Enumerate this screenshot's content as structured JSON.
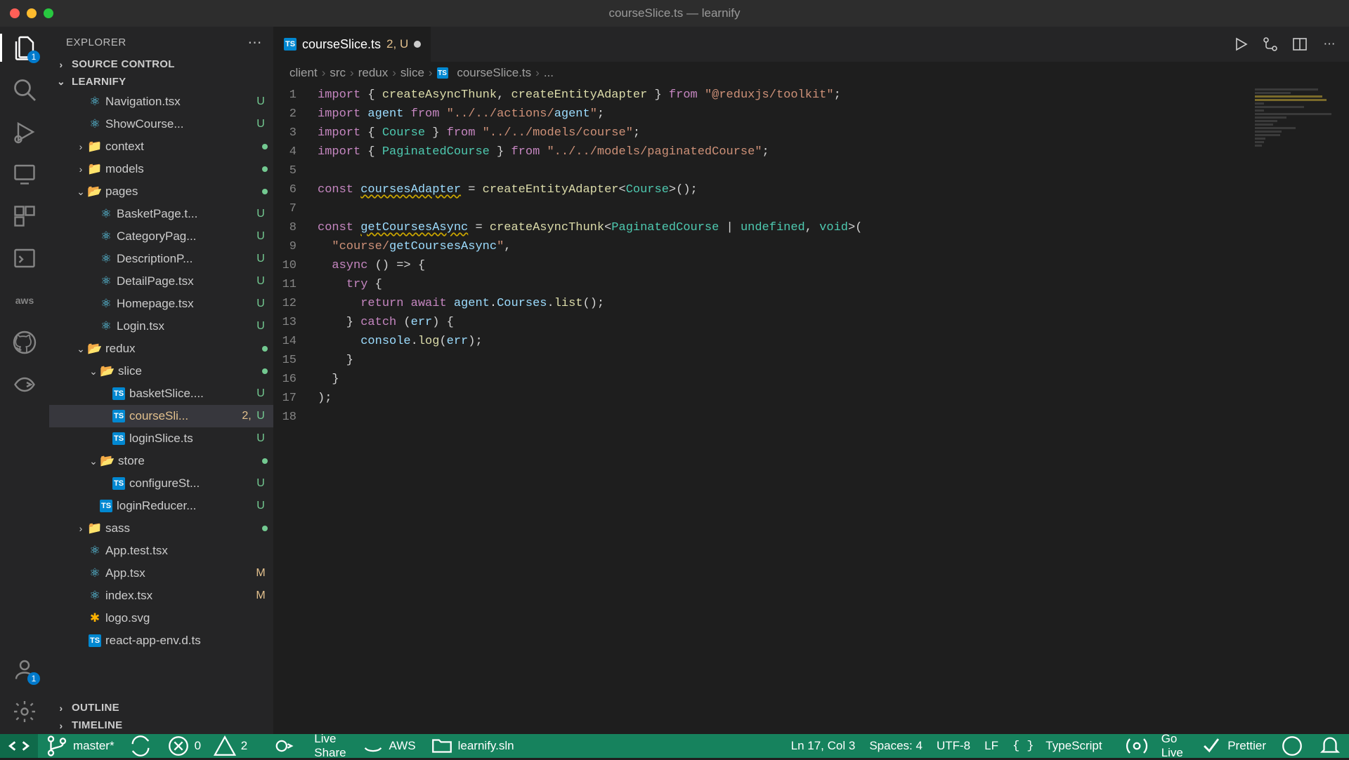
{
  "window_title": "courseSlice.ts — learnify",
  "sidebar": {
    "title": "EXPLORER",
    "sections": {
      "source_control": "SOURCE CONTROL",
      "project": "LEARNIFY",
      "outline": "OUTLINE",
      "timeline": "TIMELINE"
    },
    "items": {
      "navigation": "Navigation.tsx",
      "showcourses": "ShowCourse...",
      "context": "context",
      "models": "models",
      "pages": "pages",
      "basketpage": "BasketPage.t...",
      "categorypag": "CategoryPag...",
      "descriptionp": "DescriptionP...",
      "detailpage": "DetailPage.tsx",
      "homepage": "Homepage.tsx",
      "login": "Login.tsx",
      "redux": "redux",
      "slice": "slice",
      "basketslice": "basketSlice....",
      "courseslice": "courseSli...",
      "courseslice_badge": "2,",
      "loginslice_file": "loginSlice.ts",
      "store": "store",
      "configurest": "configureSt...",
      "loginreducer": "loginReducer...",
      "sass": "sass",
      "apptest": "App.test.tsx",
      "apptsx": "App.tsx",
      "indextsx": "index.tsx",
      "logosvg": "logo.svg",
      "reactappenv": "react-app-env.d.ts"
    }
  },
  "tab": {
    "filename": "courseSlice.ts",
    "badge": "2, U"
  },
  "breadcrumbs": {
    "client": "client",
    "src": "src",
    "redux": "redux",
    "slice": "slice",
    "file": "courseSlice.ts",
    "ellipsis": "..."
  },
  "code_lines": [
    "import { createAsyncThunk, createEntityAdapter } from \"@reduxjs/toolkit\";",
    "import agent from \"../../actions/agent\";",
    "import { Course } from \"../../models/course\";",
    "import { PaginatedCourse } from \"../../models/paginatedCourse\";",
    "",
    "const coursesAdapter = createEntityAdapter<Course>();",
    "",
    "const getCoursesAsync = createAsyncThunk<PaginatedCourse | undefined, void>(",
    "  \"course/getCoursesAsync\",",
    "  async () => {",
    "    try {",
    "      return await agent.Courses.list();",
    "    } catch (err) {",
    "      console.log(err);",
    "    }",
    "  }",
    ");",
    ""
  ],
  "statusbar": {
    "branch": "master*",
    "errors": "0",
    "warnings": "2",
    "liveshare": "Live Share",
    "aws": "AWS",
    "solution": "learnify.sln",
    "position": "Ln 17, Col 3",
    "spaces": "Spaces: 4",
    "encoding": "UTF-8",
    "eol": "LF",
    "language": "TypeScript",
    "golive": "Go Live",
    "prettier": "Prettier"
  },
  "activity_badge_files": "1",
  "activity_badge_accounts": "1"
}
